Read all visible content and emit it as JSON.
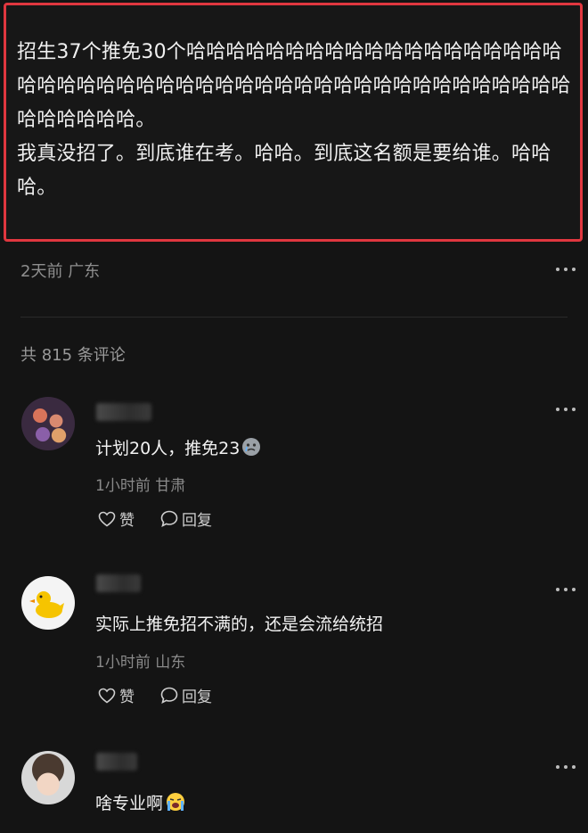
{
  "post": {
    "text": "招生37个推免30个哈哈哈哈哈哈哈哈哈哈哈哈哈哈哈哈哈哈哈哈哈哈哈哈哈哈哈哈哈哈哈哈哈哈哈哈哈哈哈哈哈哈哈哈哈哈哈哈哈哈哈哈哈。\n我真没招了。到底谁在考。哈哈。到底这名额是要给谁。哈哈哈。",
    "time": "2天前",
    "location": "广东"
  },
  "comments_count_label": "共 815 条评论",
  "actions": {
    "like_label": "赞",
    "reply_label": "回复"
  },
  "comments": [
    {
      "text": "计划20人，推免23",
      "time": "1小时前",
      "location": "甘肃",
      "emoji": "crying-emoji"
    },
    {
      "text": "实际上推免招不满的，还是会流给统招",
      "time": "1小时前",
      "location": "山东"
    },
    {
      "text": "啥专业啊",
      "emoji": "crying-emoji"
    }
  ],
  "colors": {
    "highlight_border": "#e0373f",
    "background": "#141414"
  }
}
